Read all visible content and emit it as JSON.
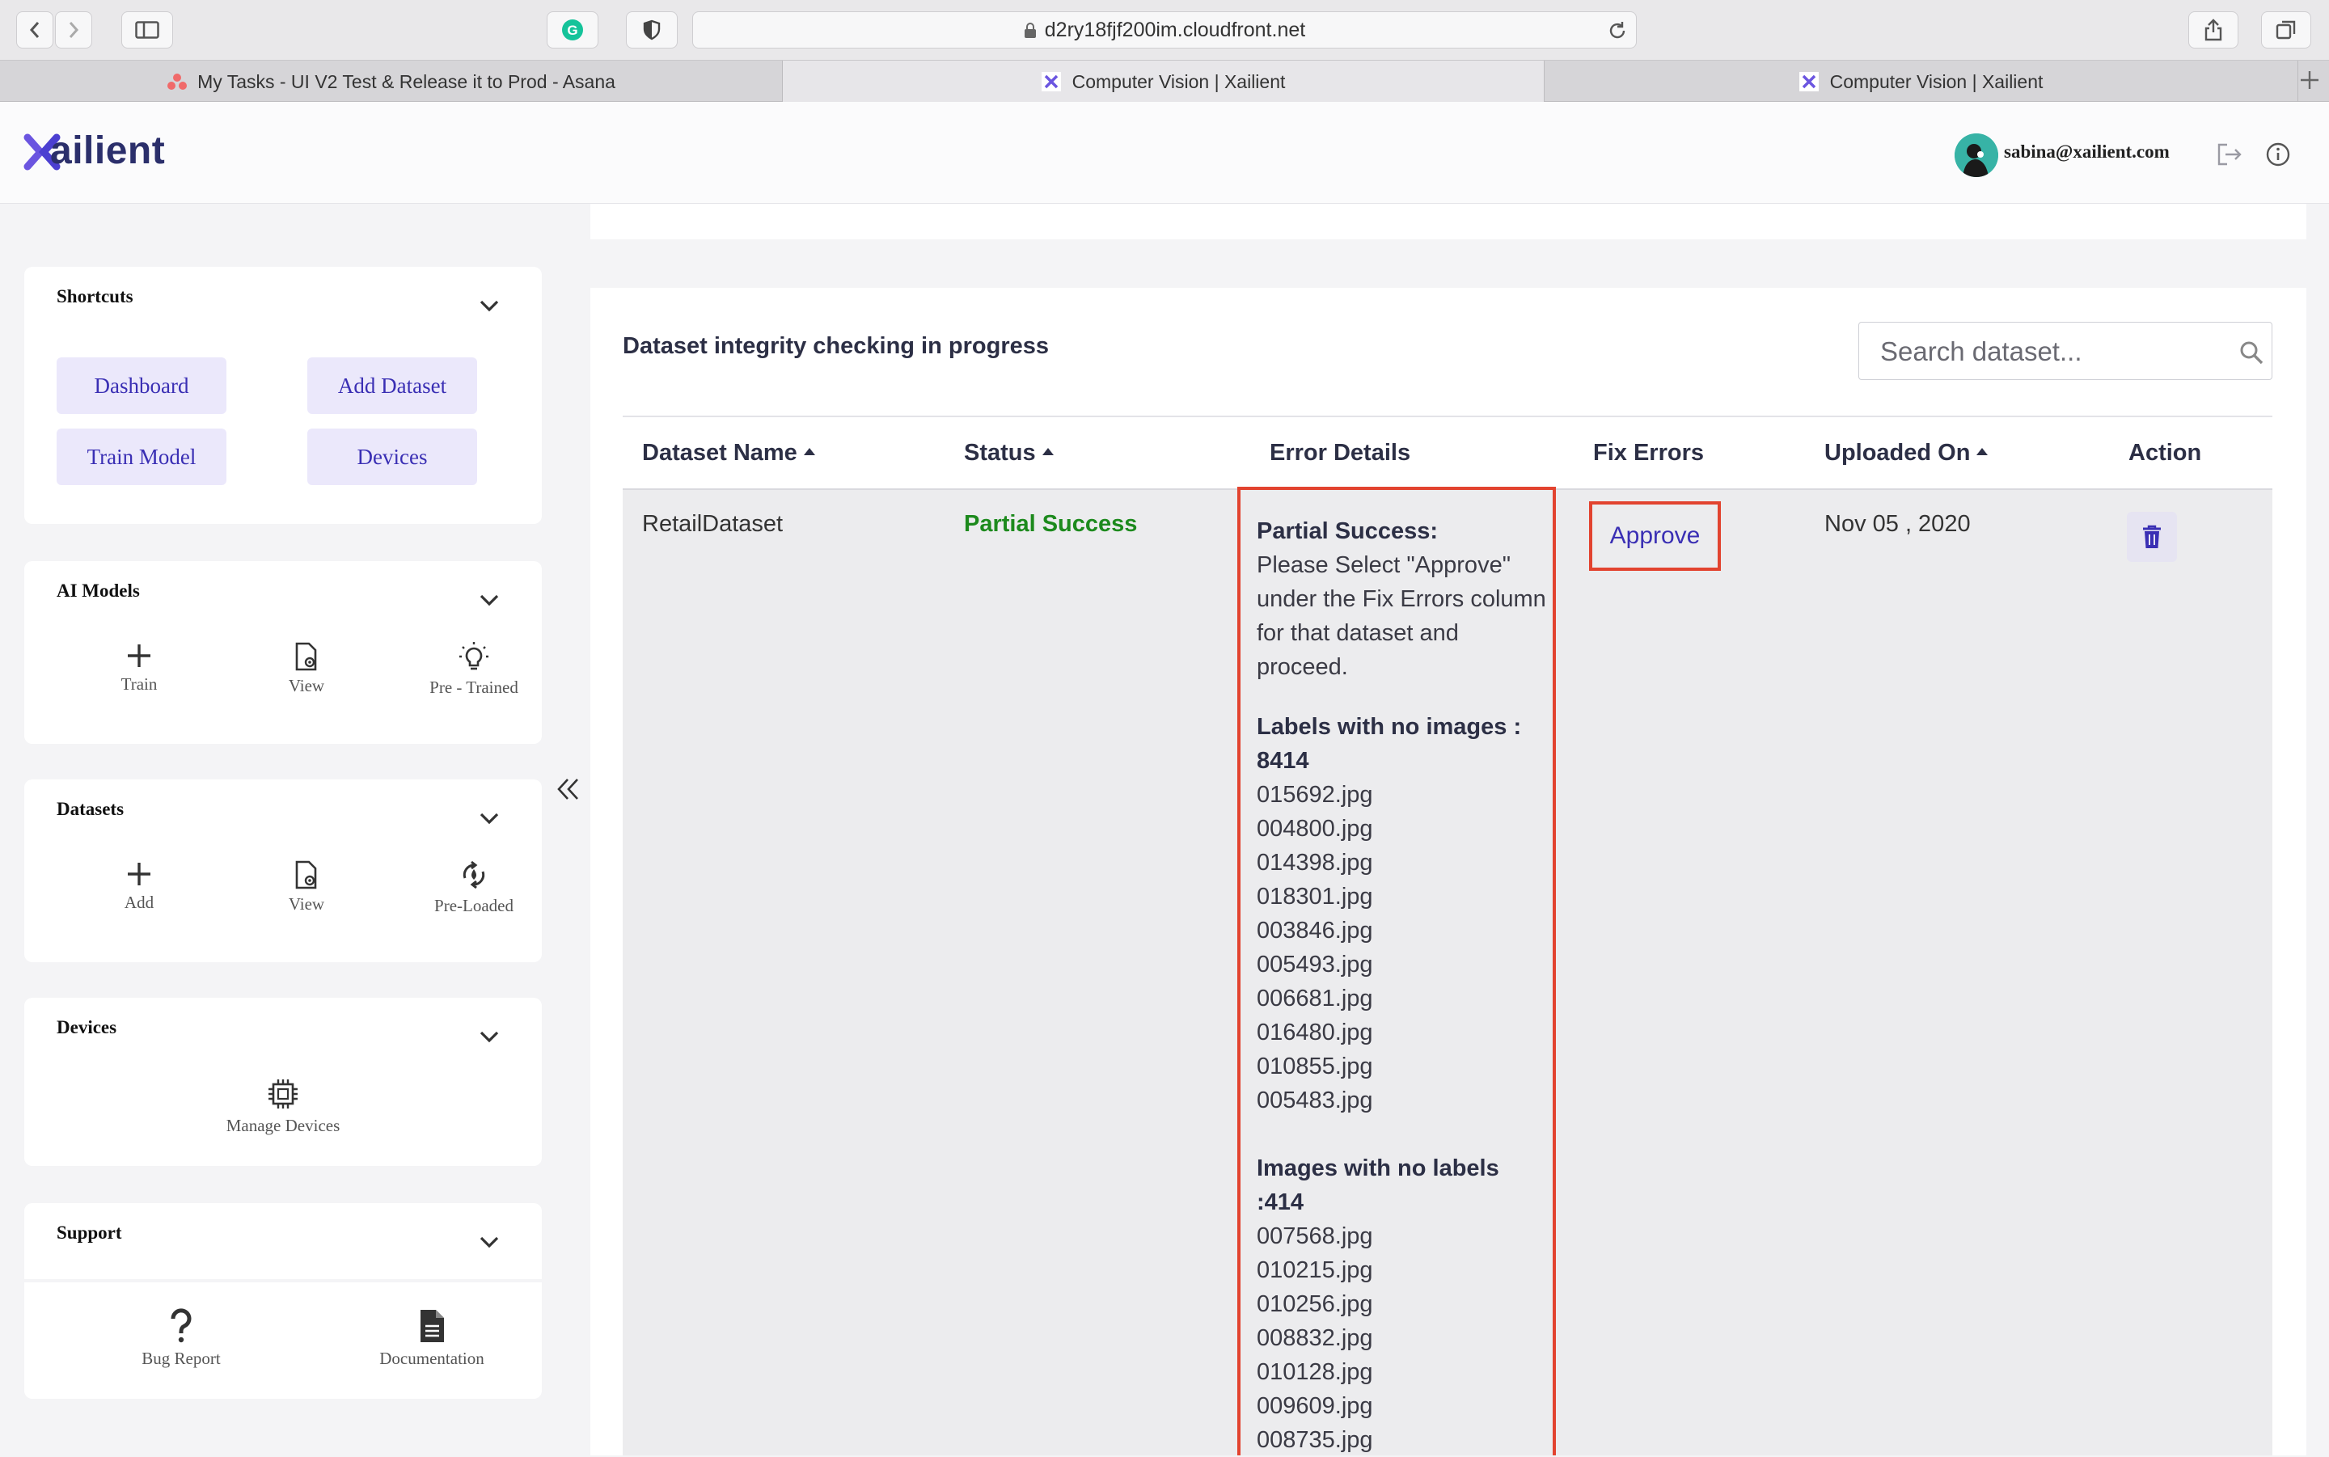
{
  "browser": {
    "url": "d2ry18fjf200im.cloudfront.net",
    "tabs": [
      {
        "label": "My Tasks - UI V2 Test & Release it to Prod - Asana",
        "active": false
      },
      {
        "label": "Computer Vision | Xailient",
        "active": true
      },
      {
        "label": "Computer Vision | Xailient",
        "active": false
      }
    ]
  },
  "header": {
    "logo": "Xailient",
    "logo_text": "ailient",
    "user_email": "sabina@xailient.com"
  },
  "sidebar": {
    "shortcuts": {
      "title": "Shortcuts",
      "buttons": [
        "Dashboard",
        "Add Dataset",
        "Train Model",
        "Devices"
      ]
    },
    "ai_models": {
      "title": "AI Models",
      "items": [
        {
          "label": "Train",
          "icon": "plus-icon"
        },
        {
          "label": "View",
          "icon": "file-view-icon"
        },
        {
          "label": "Pre - Trained",
          "icon": "lightbulb-icon"
        }
      ]
    },
    "datasets": {
      "title": "Datasets",
      "items": [
        {
          "label": "Add",
          "icon": "plus-icon"
        },
        {
          "label": "View",
          "icon": "file-view-icon"
        },
        {
          "label": "Pre-Loaded",
          "icon": "sync-icon"
        }
      ]
    },
    "devices": {
      "title": "Devices",
      "items": [
        {
          "label": "Manage Devices",
          "icon": "chip-icon"
        }
      ]
    },
    "support": {
      "title": "Support",
      "items": [
        {
          "label": "Bug Report",
          "icon": "question-icon"
        },
        {
          "label": "Documentation",
          "icon": "document-icon"
        }
      ]
    }
  },
  "main": {
    "heading": "Dataset integrity checking in progress",
    "search_placeholder": "Search dataset...",
    "columns": [
      "Dataset Name",
      "Status",
      "Error Details",
      "Fix Errors",
      "Uploaded On",
      "Action"
    ],
    "row": {
      "dataset_name": "RetailDataset",
      "status": "Partial Success",
      "error_details": {
        "heading": "Partial Success:",
        "message": "Please Select \"Approve\" under the Fix Errors column for that dataset and proceed.",
        "labels_no_images_heading": "Labels with no images : 8414",
        "labels_no_images": [
          "015692.jpg",
          "004800.jpg",
          "014398.jpg",
          "018301.jpg",
          "003846.jpg",
          "005493.jpg",
          "006681.jpg",
          "016480.jpg",
          "010855.jpg",
          "005483.jpg"
        ],
        "images_no_labels_heading": "Images with no labels :414",
        "images_no_labels": [
          "007568.jpg",
          "010215.jpg",
          "010256.jpg",
          "008832.jpg",
          "010128.jpg",
          "009609.jpg",
          "008735.jpg"
        ]
      },
      "fix_action": "Approve",
      "uploaded_on": "Nov 05 , 2020"
    }
  },
  "colors": {
    "accent": "#3a2fb4",
    "success": "#1d8a1d",
    "highlight": "#e2432f",
    "brand_navy": "#2b2f6b"
  }
}
